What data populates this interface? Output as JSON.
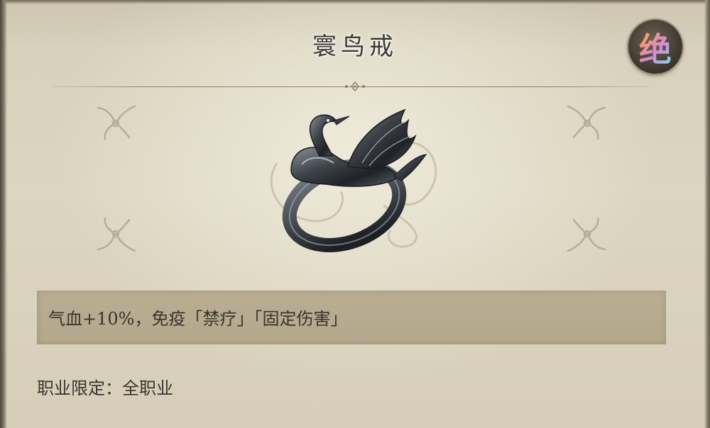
{
  "item": {
    "name": "寰鸟戒",
    "rarity": "绝",
    "description": "气血+10%，免疫「禁疗」「固定伤害」",
    "profession_label": "职业限定：",
    "profession_value": "全职业"
  },
  "colors": {
    "parchment": "#dcd5c1",
    "desc_bar": "#b7ab90",
    "text": "#3a352d",
    "rarity_gold": "#f5d37a"
  },
  "icons": {
    "item_icon": "swan-ring-icon",
    "rarity_icon": "rarity-badge-icon",
    "corner_ornament": "fleur-ornament-icon"
  }
}
